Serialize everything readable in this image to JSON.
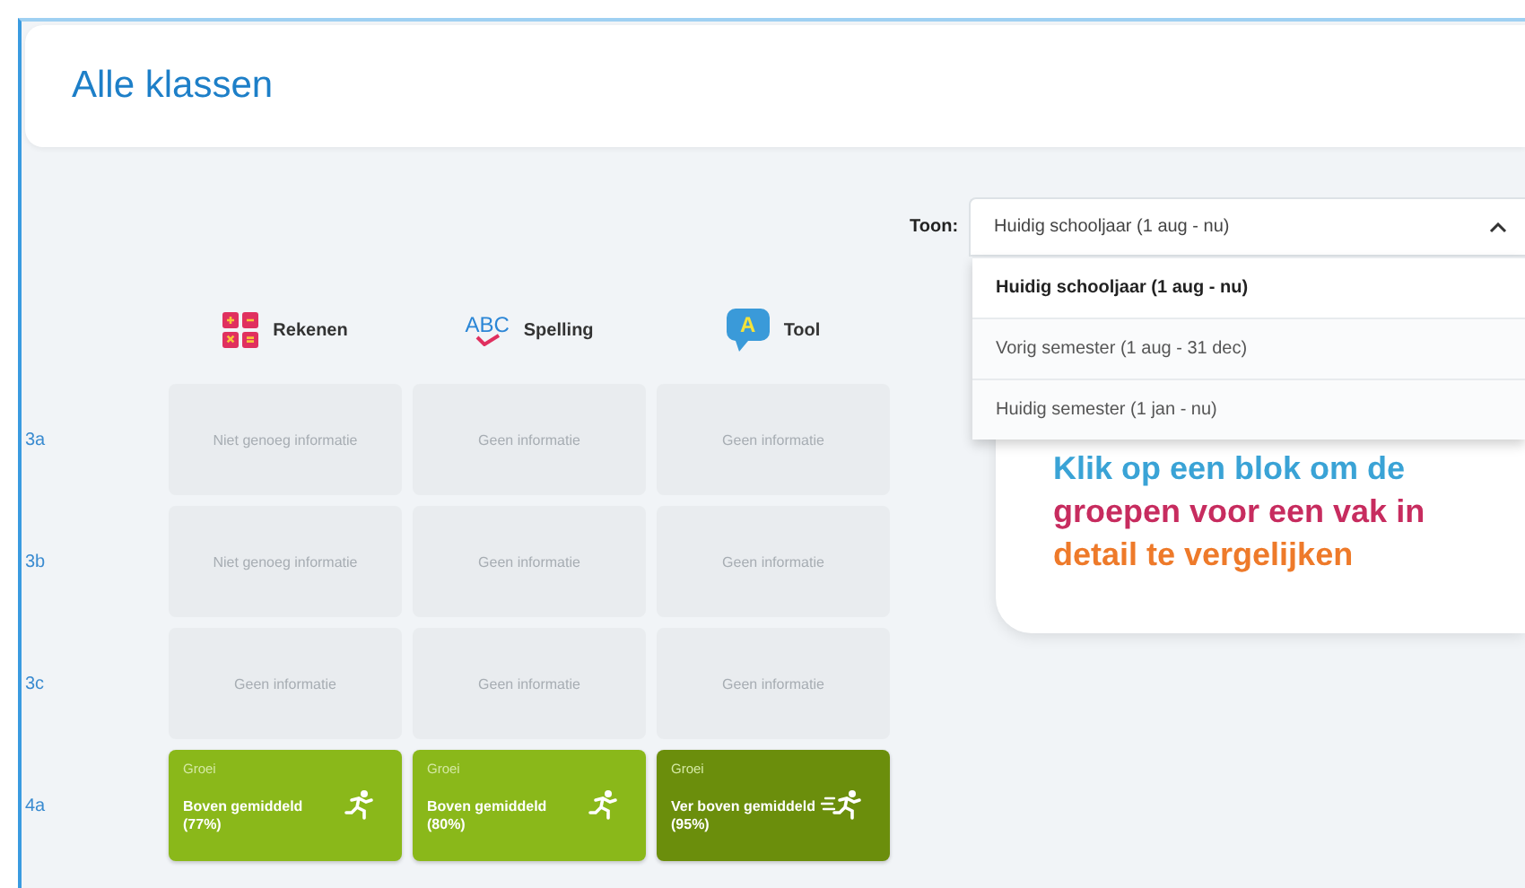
{
  "header": {
    "title": "Alle klassen"
  },
  "filter": {
    "label": "Toon:",
    "value": "Huidig schooljaar (1 aug - nu)",
    "expanded": true,
    "options": [
      {
        "label": "Huidig schooljaar (1 aug - nu)",
        "selected": true
      },
      {
        "label": "Vorig semester (1 aug - 31 dec)",
        "selected": false
      },
      {
        "label": "Huidig semester (1 jan - nu)",
        "selected": false
      }
    ]
  },
  "subjects": [
    {
      "name": "Rekenen",
      "kind": "math"
    },
    {
      "name": "Spelling",
      "kind": "spelling",
      "icon_text": "ABC"
    },
    {
      "name": "Tool",
      "kind": "language",
      "icon_text": "A"
    }
  ],
  "rows": [
    {
      "group": "3a",
      "cells": [
        {
          "kind": "empty",
          "text": "Niet genoeg informatie"
        },
        {
          "kind": "empty",
          "text": "Geen informatie"
        },
        {
          "kind": "empty",
          "text": "Geen informatie"
        }
      ]
    },
    {
      "group": "3b",
      "cells": [
        {
          "kind": "empty",
          "text": "Niet genoeg informatie"
        },
        {
          "kind": "empty",
          "text": "Geen informatie"
        },
        {
          "kind": "empty",
          "text": "Geen informatie"
        }
      ]
    },
    {
      "group": "3c",
      "cells": [
        {
          "kind": "empty",
          "text": "Geen informatie"
        },
        {
          "kind": "empty",
          "text": "Geen informatie"
        },
        {
          "kind": "empty",
          "text": "Geen informatie"
        }
      ]
    },
    {
      "group": "4a",
      "cells": [
        {
          "kind": "growth",
          "label": "Groei",
          "text": "Boven gemiddeld",
          "value": "(77%)"
        },
        {
          "kind": "growth",
          "label": "Groei",
          "text": "Boven gemiddeld",
          "value": "(80%)"
        },
        {
          "kind": "high_growth",
          "label": "Groei",
          "text": "Ver boven gemiddeld",
          "value": "(95%)"
        }
      ]
    }
  ],
  "tip": {
    "lines": [
      {
        "text": "Klik op een blok om de",
        "color": "#3aa3d6"
      },
      {
        "text": "groepen voor een vak in",
        "color": "#c72c5f"
      },
      {
        "text": "detail te vergelijken",
        "color": "#ee7a2a"
      }
    ]
  }
}
